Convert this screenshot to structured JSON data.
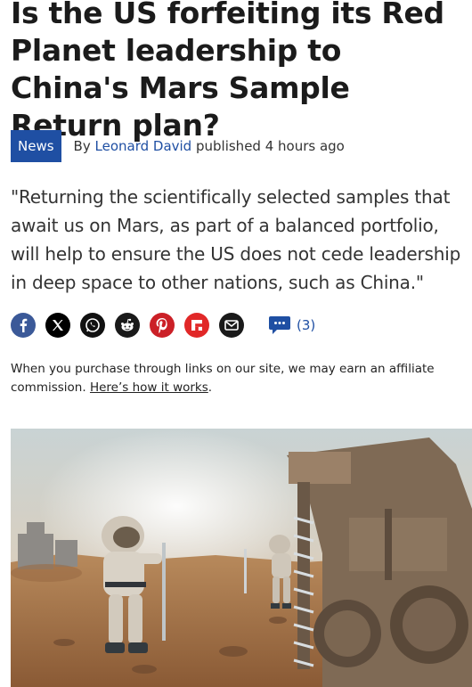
{
  "article": {
    "headline": "Is the US forfeiting its Red Planet leadership to China's Mars Sample Return plan?",
    "category": "News",
    "byline_prefix": "By",
    "author": "Leonard David",
    "published": "published 4 hours ago",
    "strapline": "\"Returning the scientifically selected samples that await us on Mars, as part of a balanced portfolio, will help to ensure the US does not cede leadership in deep space to other nations, such as China.\""
  },
  "share": {
    "buttons": [
      {
        "icon": "facebook-icon",
        "color": "#3b5998"
      },
      {
        "icon": "x-icon",
        "color": "#000000"
      },
      {
        "icon": "whatsapp-icon",
        "color": "#111111"
      },
      {
        "icon": "reddit-icon",
        "color": "#1a1a1a"
      },
      {
        "icon": "pinterest-icon",
        "color": "#cb2027"
      },
      {
        "icon": "flipboard-icon",
        "color": "#e12828"
      },
      {
        "icon": "email-icon",
        "color": "#1a1a1a"
      }
    ],
    "comment_count": "(3)",
    "comment_icon_color": "#1f4fa3"
  },
  "affiliate": {
    "text": "When you purchase through links on our site, we may earn an affiliate commission.",
    "link_text": "Here’s how it works",
    "suffix": "."
  },
  "hero_image": {
    "description_icon": "mars-astronauts-drilling-illustration"
  }
}
